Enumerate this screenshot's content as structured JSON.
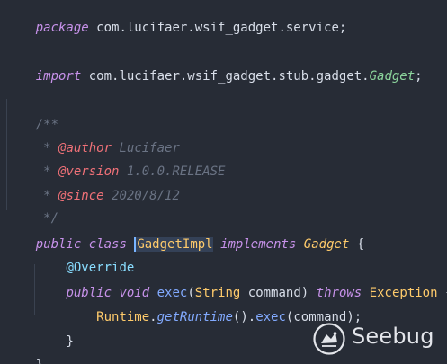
{
  "editor": {
    "line1": {
      "keyword": "package",
      "package_name": " com.lucifaer.wsif_gadget.service;"
    },
    "line2": {
      "keyword": "import",
      "package_name": " com.lucifaer.wsif_gadget.stub.gadget.",
      "class_name": "Gadget",
      "semicolon": ";"
    },
    "doc_open": "/**",
    "doc_author_prefix": " * ",
    "doc_author_tag": "@author",
    "doc_author_value": " Lucifaer",
    "doc_version_prefix": " * ",
    "doc_version_tag": "@version",
    "doc_version_value": " 1.0.0.RELEASE",
    "doc_since_prefix": " * ",
    "doc_since_tag": "@since",
    "doc_since_value": " 2020/8/12",
    "doc_close": " */",
    "class_decl": {
      "kw_public": "public",
      "kw_class": "class",
      "name": "GadgetImpl",
      "kw_implements": "implements",
      "interface": "Gadget",
      "brace": " {"
    },
    "annotation": "@Override",
    "method_decl": {
      "kw_public": "public",
      "kw_void": "void",
      "name": "exec",
      "params_open": "(",
      "param_type": "String",
      "param_name": " command",
      "params_close": ")",
      "kw_throws": "throws",
      "exception": "Exception",
      "brace": " {"
    },
    "body_line": {
      "receiver": "Runtime",
      "dot1": ".",
      "getter": "getRuntime",
      "call": "().",
      "method": "exec",
      "args": "(command);"
    },
    "method_close": "}",
    "class_close": "}"
  },
  "watermark": {
    "text": "Seebug"
  },
  "colors": {
    "background": "#272c36",
    "keyword": "#c792ea",
    "comment": "#6a7384",
    "doc_tag": "#f07178",
    "annotation": "#89ddff",
    "class_name": "#ffcb6b",
    "method": "#82aaff",
    "imported_type": "#8bd49c",
    "plain_text": "#d8dee9"
  },
  "icons": {
    "watermark_logo": "seebug-logo-icon"
  }
}
